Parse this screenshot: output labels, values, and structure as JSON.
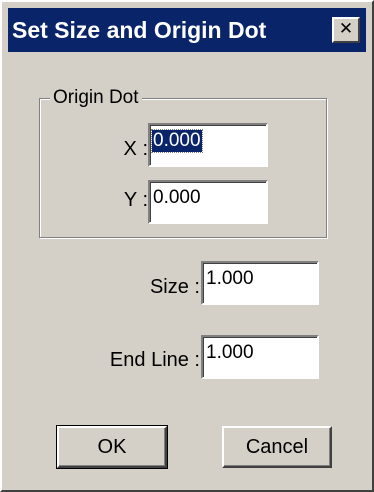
{
  "window": {
    "title": "Set Size and Origin Dot",
    "close_symbol": "✕"
  },
  "origin_group": {
    "legend": "Origin Dot",
    "x_label": "X :",
    "x_value": "0.000",
    "y_label": "Y :",
    "y_value": "0.000"
  },
  "size": {
    "label": "Size :",
    "value": "1.000"
  },
  "end_line": {
    "label": "End Line :",
    "value": "1.000"
  },
  "buttons": {
    "ok": "OK",
    "cancel": "Cancel"
  },
  "colors": {
    "titlebar": "#0a246a",
    "face": "#d4d0c8",
    "selection": "#0a246a"
  }
}
